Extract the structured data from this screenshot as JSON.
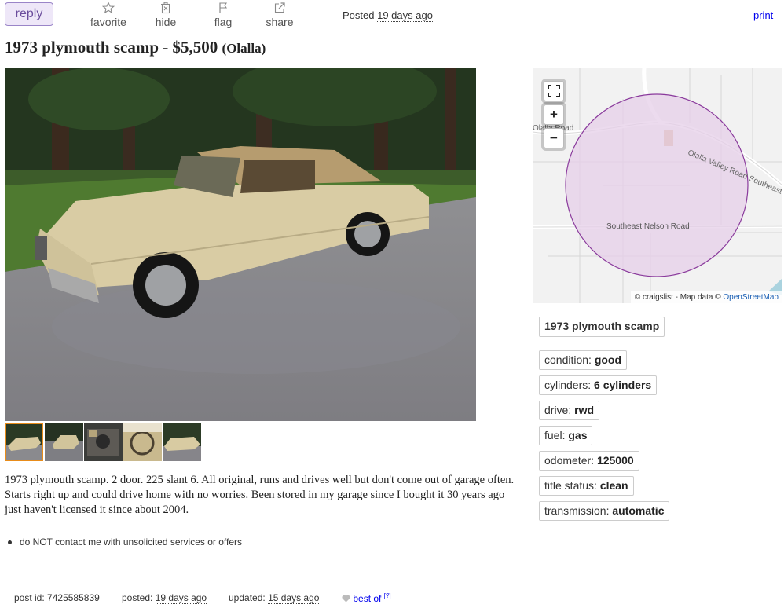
{
  "toolbar": {
    "reply_label": "reply",
    "favorite_label": "favorite",
    "hide_label": "hide",
    "flag_label": "flag",
    "share_label": "share",
    "posted_prefix": "Posted",
    "posted_age": "19 days ago",
    "print_label": "print"
  },
  "listing": {
    "title": "1973 plymouth scamp",
    "separator": " - ",
    "price": "$5,500",
    "location": "(Olalla)",
    "description": "1973 plymouth scamp. 2 door. 225 slant 6. All original, runs and drives well but don't come out of garage often. Starts right up and could drive home with no worries. Been stored in my garage since I bought it 30 years ago just haven't licensed it since about 2004.",
    "notice": "do NOT contact me with unsolicited services or offers"
  },
  "map": {
    "road_1": "Olalla Road",
    "road_2": "Olalla Valley Road Southeast",
    "road_3": "Southeast Nelson Road",
    "attribution_prefix": "© craigslist - Map data ©",
    "attribution_link": "OpenStreetMap",
    "area_color": "#e6cfe8",
    "area_border": "#8a3a9c"
  },
  "attributes": {
    "title": "1973 plymouth scamp",
    "items": [
      {
        "label": "condition:",
        "value": "good"
      },
      {
        "label": "cylinders:",
        "value": "6 cylinders"
      },
      {
        "label": "drive:",
        "value": "rwd"
      },
      {
        "label": "fuel:",
        "value": "gas"
      },
      {
        "label": "odometer:",
        "value": "125000"
      },
      {
        "label": "title status:",
        "value": "clean"
      },
      {
        "label": "transmission:",
        "value": "automatic"
      }
    ]
  },
  "footer": {
    "post_id_label": "post id:",
    "post_id": "7425585839",
    "posted_label": "posted:",
    "posted_value": "19 days ago",
    "updated_label": "updated:",
    "updated_value": "15 days ago",
    "best_of": "best of",
    "best_of_help": "[?]"
  },
  "icons": {
    "favorite": "star-icon",
    "hide": "trash-x-icon",
    "flag": "flag-icon",
    "share": "share-arrow-icon"
  }
}
